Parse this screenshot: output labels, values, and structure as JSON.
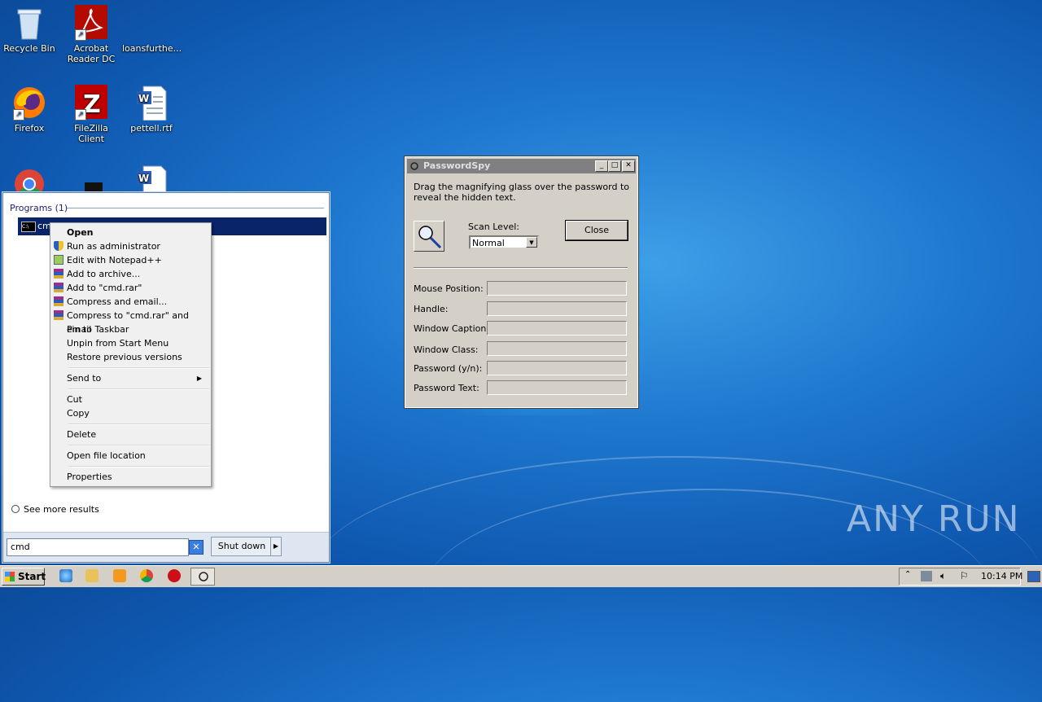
{
  "desktop": {
    "icons": [
      {
        "label": "Recycle Bin",
        "icon": "recycle-bin-icon"
      },
      {
        "label": "Acrobat Reader DC",
        "icon": "acrobat-icon"
      },
      {
        "label": "loansfurthe...",
        "icon": "file-icon"
      },
      {
        "label": "Firefox",
        "icon": "firefox-icon"
      },
      {
        "label": "FileZilla Client",
        "icon": "filezilla-icon"
      },
      {
        "label": "pettell.rtf",
        "icon": "word-doc-icon"
      }
    ]
  },
  "start_menu": {
    "programs_header": "Programs (1)",
    "program_item": "cmd",
    "see_more": "See more results",
    "search_value": "cmd",
    "shutdown_label": "Shut down"
  },
  "context_menu": {
    "open": "Open",
    "run_admin": "Run as administrator",
    "edit_npp": "Edit with Notepad++",
    "add_archive": "Add to archive...",
    "add_cmd_rar": "Add to \"cmd.rar\"",
    "compress_email": "Compress and email...",
    "compress_cmd_email": "Compress to \"cmd.rar\" and email",
    "pin_taskbar": "Pin to Taskbar",
    "unpin_start": "Unpin from Start Menu",
    "restore_versions": "Restore previous versions",
    "send_to": "Send to",
    "cut": "Cut",
    "copy": "Copy",
    "delete": "Delete",
    "open_location": "Open file location",
    "properties": "Properties"
  },
  "passwordspy": {
    "title": "PasswordSpy",
    "description": "Drag the magnifying glass over the password to reveal the hidden text.",
    "scan_level_label": "Scan Level:",
    "scan_level_value": "Normal",
    "close_label": "Close",
    "fields": {
      "mouse_position": "Mouse Position:",
      "handle": "Handle:",
      "window_caption": "Window Caption:",
      "window_class": "Window Class:",
      "password_yn": "Password (y/n):",
      "password_text": "Password Text:"
    }
  },
  "taskbar": {
    "start_label": "Start",
    "clock": "10:14 PM"
  },
  "watermark": "ANY RUN"
}
